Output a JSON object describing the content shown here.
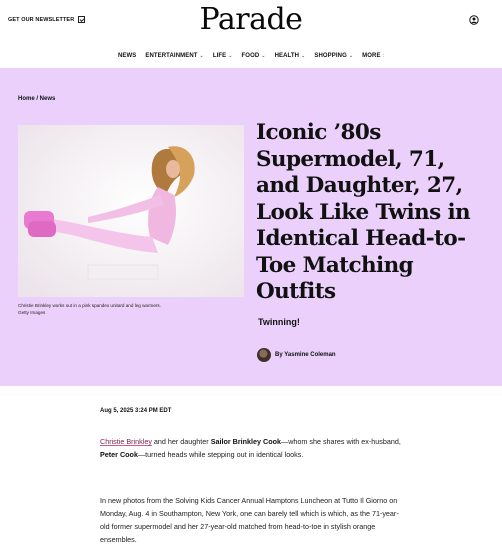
{
  "header": {
    "newsletter_label": "GET OUR NEWSLETTER",
    "logo": "Parade"
  },
  "nav": {
    "items": [
      {
        "label": "NEWS",
        "has_dropdown": false
      },
      {
        "label": "ENTERTAINMENT",
        "has_dropdown": true
      },
      {
        "label": "LIFE",
        "has_dropdown": true
      },
      {
        "label": "FOOD",
        "has_dropdown": true
      },
      {
        "label": "HEALTH",
        "has_dropdown": true
      },
      {
        "label": "SHOPPING",
        "has_dropdown": true
      },
      {
        "label": "MORE",
        "has_dropdown": false
      }
    ],
    "more_marker": ":"
  },
  "hero": {
    "breadcrumb": "Home / News",
    "headline": "Iconic ’80s Supermodel, 71, and Daughter, 27, Look Like Twins in Identical Head-to-Toe Matching Outfits",
    "dek": "Twinning!",
    "byline": "By Yasmine Coleman",
    "caption_line1": "Christie Brinkley works out in a pink spandex unitard and leg warmers.",
    "caption_line2": "Getty Images",
    "background_color": "#ebd0fb"
  },
  "article": {
    "date": "Aug 5, 2025 3:24 PM EDT",
    "p1": {
      "link": "Christie Brinkley",
      "t1": " and her daughter ",
      "b1": "Sailor Brinkley Cook",
      "t2": "—whom she shares with ex-husband, ",
      "b2": "Peter Cook",
      "t3": "—turned heads while stepping out in identical looks."
    },
    "p2": "In new photos from the Solving Kids Cancer Annual Hamptons Luncheon at Tutto Il Giorno on Monday, Aug. 4 in Southampton, New York, one can barely tell which is which, as the 71-year-old former supermodel and her 27-year-old matched from head-to-toe in stylish orange ensembles."
  },
  "icons": {
    "newsletter": "newsletter-icon",
    "account": "account-icon",
    "dropdown": "chevron-down-icon"
  }
}
